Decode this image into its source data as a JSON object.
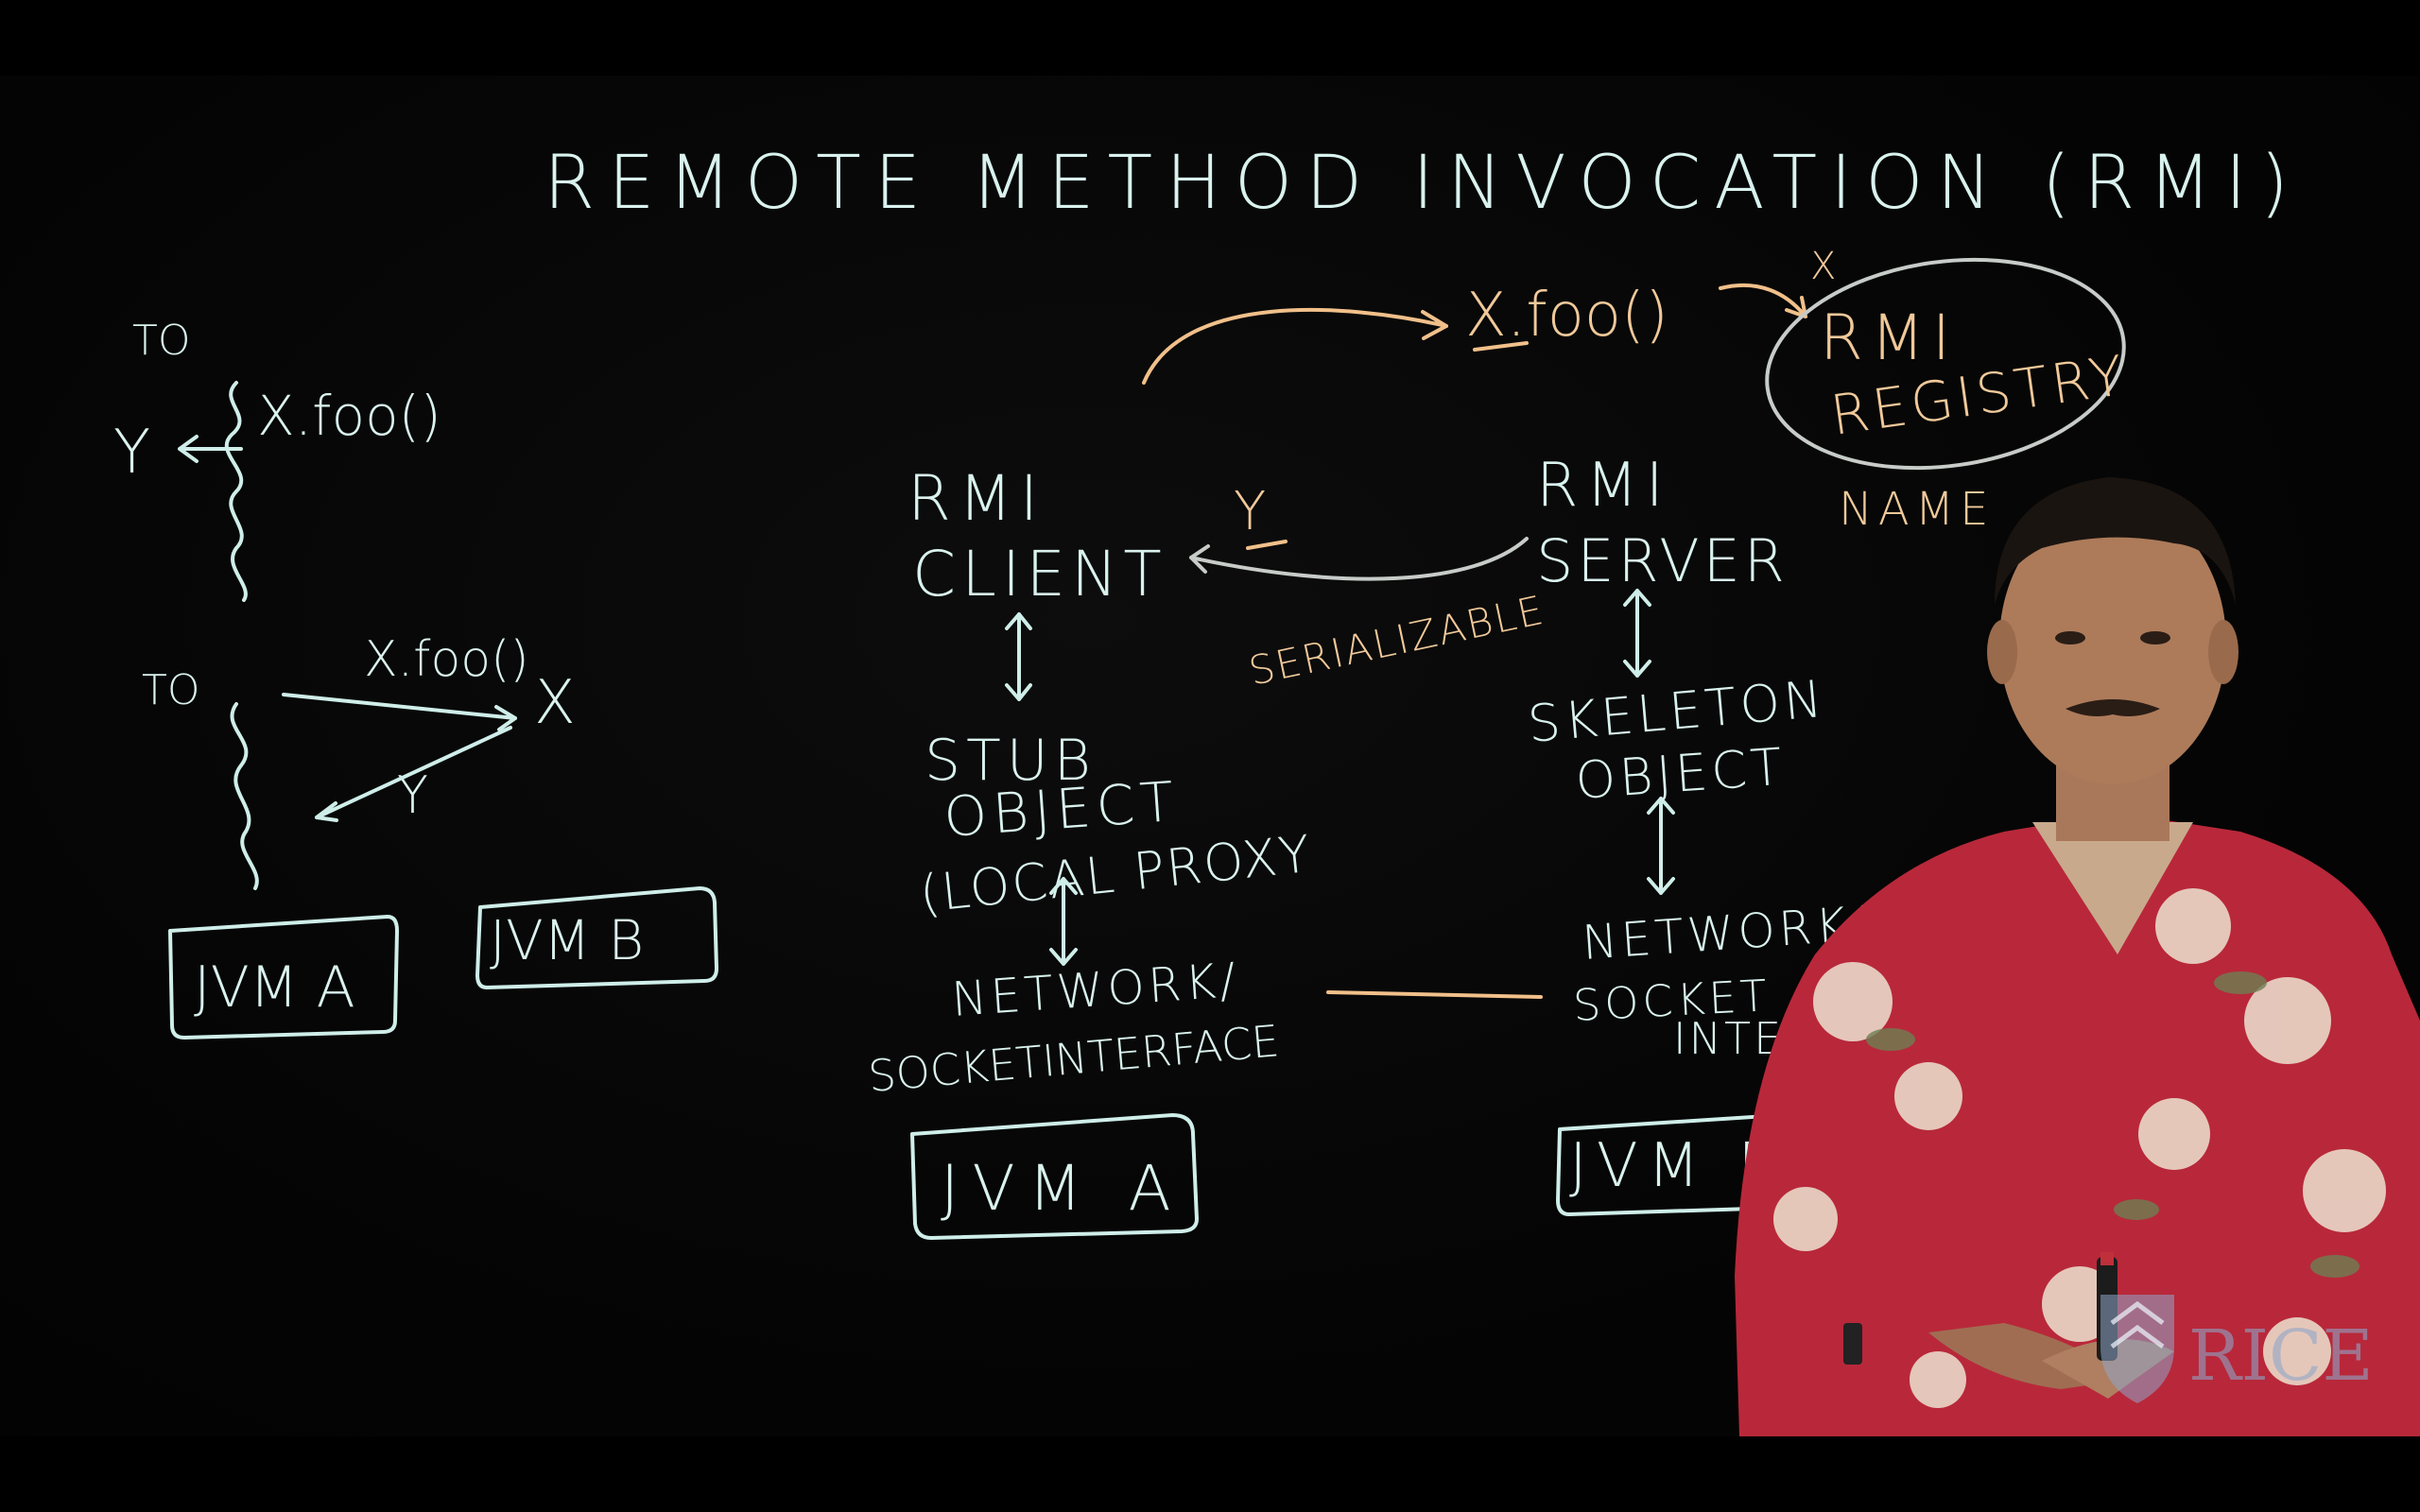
{
  "board": {
    "title": "REMOTE METHOD INVOCATION (RMI)",
    "left_top": {
      "t0": "TO",
      "y": "Y",
      "call": "X.foo()"
    },
    "left_mid": {
      "t0": "TO",
      "call": "X.foo()",
      "x": "X",
      "y": "Y"
    },
    "left_jvm_a": "JVM A",
    "left_jvm_b": "JVM B",
    "call_top": "X.foo()",
    "x_mark": "X",
    "registry_line1": "RMI",
    "registry_line2": "REGISTRY",
    "name": "NAME",
    "client_line1": "RMI",
    "client_line2": "CLIENT",
    "return_y": "Y",
    "serializable": "SERIALIZABLE",
    "server_line1": "RMI",
    "server_line2": "SERVER",
    "stub_line1": "STUB",
    "stub_line2": "OBJECT",
    "stub_line3": "(LOCAL PROXY",
    "skeleton_line1": "SKELETON",
    "skeleton_line2": "OBJECT",
    "net_left_line1": "NETWORK/",
    "net_left_line2": "SOCKETINTERFACE",
    "net_right_line1": "NETWORK/",
    "net_right_line2": "SOCKET",
    "net_right_line3": "INTERFACE",
    "jvm_a": "JVM A",
    "jvm_b": "JVM B"
  },
  "logo": {
    "text": "RICE"
  },
  "colors": {
    "chalk_cyan": "#d9f2ee",
    "chalk_orange": "#f0c99a",
    "shirt": "#b8283a"
  }
}
